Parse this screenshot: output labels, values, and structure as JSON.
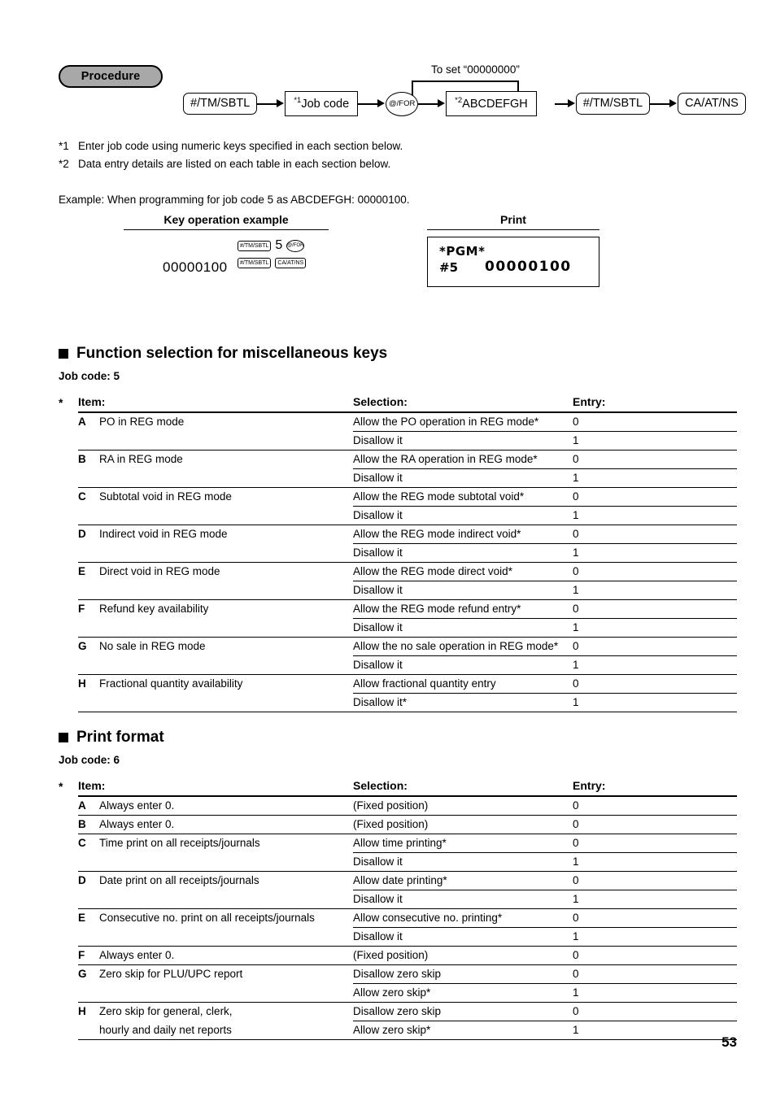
{
  "procedure": {
    "badge_label": "Procedure",
    "loop_label": "To set “00000000”",
    "steps": [
      {
        "type": "key-round",
        "label": "#/TM/SBTL"
      },
      {
        "type": "key-rect",
        "label": "Job code",
        "sup": "*1"
      },
      {
        "type": "key-oval",
        "label": "@/FOR"
      },
      {
        "type": "key-rect",
        "label": "ABCDEFGH",
        "sup": "*2"
      },
      {
        "type": "key-round",
        "label": "#/TM/SBTL"
      },
      {
        "type": "key-round",
        "label": "CA/AT/NS"
      }
    ],
    "footnotes": [
      {
        "marker": "*1",
        "text": "Enter job code using numeric keys specified in each section below."
      },
      {
        "marker": "*2",
        "text": "Data entry details are listed on each table in each section below."
      }
    ],
    "example_line": "Example:  When programming for job code 5 as ABCDEFGH: 00000100."
  },
  "example": {
    "key_operation_heading": "Key operation example",
    "print_heading": "Print",
    "key_sequence": {
      "amount": "00000100",
      "row1": [
        "#/TM/SBTL",
        "5",
        "@/FOR"
      ],
      "row2": [
        "#/TM/SBTL",
        "CA/AT/NS"
      ]
    },
    "print_receipt": {
      "line1": "*PGM*",
      "line2_label": "#5",
      "line2_value": "00000100"
    }
  },
  "sections": [
    {
      "title": "Function selection for miscellaneous keys",
      "job_code_label": "Job code:",
      "job_code_value": "5",
      "columns": {
        "star": "*",
        "item": "Item:",
        "selection": "Selection:",
        "entry": "Entry:"
      },
      "rows": [
        {
          "letter": "A",
          "item": "PO in REG mode",
          "options": [
            {
              "selection": "Allow the PO operation in REG mode*",
              "entry": "0"
            },
            {
              "selection": "Disallow it",
              "entry": "1"
            }
          ]
        },
        {
          "letter": "B",
          "item": "RA in REG mode",
          "options": [
            {
              "selection": "Allow the RA operation in REG mode*",
              "entry": "0"
            },
            {
              "selection": "Disallow it",
              "entry": "1"
            }
          ]
        },
        {
          "letter": "C",
          "item": "Subtotal void in REG mode",
          "options": [
            {
              "selection": "Allow the REG mode subtotal void*",
              "entry": "0"
            },
            {
              "selection": "Disallow it",
              "entry": "1"
            }
          ]
        },
        {
          "letter": "D",
          "item": "Indirect void in REG mode",
          "options": [
            {
              "selection": "Allow the REG mode indirect void*",
              "entry": "0"
            },
            {
              "selection": "Disallow it",
              "entry": "1"
            }
          ]
        },
        {
          "letter": "E",
          "item": "Direct void in REG mode",
          "options": [
            {
              "selection": "Allow the REG mode direct void*",
              "entry": "0"
            },
            {
              "selection": "Disallow it",
              "entry": "1"
            }
          ]
        },
        {
          "letter": "F",
          "item": "Refund key availability",
          "options": [
            {
              "selection": "Allow the REG mode refund entry*",
              "entry": "0"
            },
            {
              "selection": "Disallow it",
              "entry": "1"
            }
          ]
        },
        {
          "letter": "G",
          "item": "No sale in REG mode",
          "options": [
            {
              "selection": "Allow the no sale operation in REG mode*",
              "entry": "0"
            },
            {
              "selection": "Disallow it",
              "entry": "1"
            }
          ]
        },
        {
          "letter": "H",
          "item": "Fractional quantity availability",
          "options": [
            {
              "selection": "Allow fractional quantity entry",
              "entry": "0"
            },
            {
              "selection": "Disallow it*",
              "entry": "1"
            }
          ]
        }
      ]
    },
    {
      "title": "Print format",
      "job_code_label": "Job code:",
      "job_code_value": "6",
      "columns": {
        "star": "*",
        "item": "Item:",
        "selection": "Selection:",
        "entry": "Entry:"
      },
      "rows": [
        {
          "letter": "A",
          "item": "Always enter 0.",
          "options": [
            {
              "selection": "(Fixed position)",
              "entry": "0"
            }
          ]
        },
        {
          "letter": "B",
          "item": "Always enter 0.",
          "options": [
            {
              "selection": "(Fixed position)",
              "entry": "0"
            }
          ]
        },
        {
          "letter": "C",
          "item": "Time print on all receipts/journals",
          "options": [
            {
              "selection": "Allow time printing*",
              "entry": "0"
            },
            {
              "selection": "Disallow it",
              "entry": "1"
            }
          ]
        },
        {
          "letter": "D",
          "item": "Date print on all receipts/journals",
          "options": [
            {
              "selection": "Allow date printing*",
              "entry": "0"
            },
            {
              "selection": "Disallow it",
              "entry": "1"
            }
          ]
        },
        {
          "letter": "E",
          "item": "Consecutive no. print on all receipts/journals",
          "options": [
            {
              "selection": "Allow consecutive no. printing*",
              "entry": "0"
            },
            {
              "selection": "Disallow it",
              "entry": "1"
            }
          ]
        },
        {
          "letter": "F",
          "item": "Always enter 0.",
          "options": [
            {
              "selection": "(Fixed position)",
              "entry": "0"
            }
          ]
        },
        {
          "letter": "G",
          "item": "Zero skip for PLU/UPC report",
          "options": [
            {
              "selection": "Disallow zero skip",
              "entry": "0"
            },
            {
              "selection": "Allow zero skip*",
              "entry": "1"
            }
          ]
        },
        {
          "letter": "H",
          "item": "Zero skip for general, clerk,",
          "item2": "hourly and daily net reports",
          "options": [
            {
              "selection": "Disallow zero skip",
              "entry": "0"
            },
            {
              "selection": "Allow zero skip*",
              "entry": "1"
            }
          ]
        }
      ]
    }
  ],
  "page_number": "53"
}
